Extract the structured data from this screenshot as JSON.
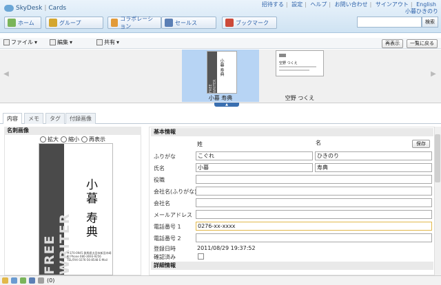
{
  "header": {
    "brand": "SkyDesk",
    "product": "Cards",
    "links": [
      "招待する",
      "設定",
      "ヘルプ",
      "お問い合わせ",
      "サインアウト",
      "English"
    ],
    "user": "小暮ひきのり",
    "search_button": "検索"
  },
  "nav": [
    {
      "label": "ホーム",
      "color": "#7ab45a"
    },
    {
      "label": "グループ",
      "color": "#d4a62f"
    },
    {
      "label": "コラボレーション",
      "color": "#e29a38"
    },
    {
      "label": "セールス",
      "color": "#5b7fb5"
    },
    {
      "label": "ブックマーク",
      "color": "#cc4a3a"
    }
  ],
  "toolbar": {
    "file": "ファイル",
    "edit": "編集",
    "share": "共有",
    "refresh": "再表示",
    "back_to_list": "一覧に戻る"
  },
  "carousel": {
    "cards": [
      {
        "caption": "小暮 寿典"
      },
      {
        "caption": "空野 つくえ"
      }
    ],
    "thumb_mark": "FREE WRITER",
    "thumb_name": "小暮 寿典",
    "thumb2_name": "空野 つくえ"
  },
  "tabs": [
    "内容",
    "メモ",
    "タグ",
    "付録画像"
  ],
  "left": {
    "title": "名刺画像",
    "zoom_in": "拡大",
    "zoom_out": "縮小",
    "redisplay": "再表示",
    "card_name": "小暮 寿典",
    "card_mark": "FREE WRITER",
    "card_address": "〒370-0945 群馬県太田市新田木崎町 Phone 080-3693-9256 TEL/FAX 0276-56-8548 E-Mail"
  },
  "form": {
    "section_basic": "基本情報",
    "col_last": "姓",
    "col_first": "名",
    "save": "保存",
    "labels": {
      "furigana": "ふりがな",
      "name": "氏名",
      "title": "役職",
      "company_kana": "会社名(ふりがな)",
      "company": "会社名",
      "email": "メールアドレス",
      "phone1": "電話番号 1",
      "phone2": "電話番号 2",
      "registered": "登録日時",
      "confirmed": "確認済み"
    },
    "values": {
      "furigana_last": "こぐれ",
      "furigana_first": "ひきのり",
      "name_last": "小暮",
      "name_first": "寿典",
      "phone1": "0276-xx-xxxx",
      "registered": "2011/08/29 19:37:52"
    },
    "section_detail": "詳細情報"
  },
  "status": {
    "count": "(0)"
  }
}
